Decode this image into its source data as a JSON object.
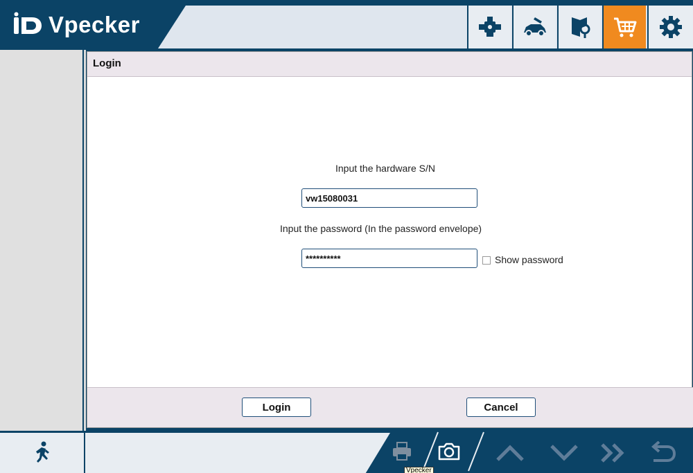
{
  "app": {
    "brand": "Vpecker",
    "logo_mark": "iD"
  },
  "header": {
    "nav": [
      {
        "icon": "engine-diagnostic-icon",
        "active": false
      },
      {
        "icon": "car-repair-icon",
        "active": false
      },
      {
        "icon": "manual-search-icon",
        "active": false
      },
      {
        "icon": "shopping-cart-icon",
        "active": true
      },
      {
        "icon": "gear-icon",
        "active": false
      }
    ]
  },
  "dialog": {
    "title": "Login",
    "sn_label": "Input the hardware S/N",
    "sn_value": "vw15080031",
    "password_label": "Input the password (In the password envelope)",
    "password_value": "**********",
    "show_password_label": "Show password",
    "show_password_checked": false,
    "login_button": "Login",
    "cancel_button": "Cancel"
  },
  "bottombar": {
    "tooltip": "Vpecker",
    "icons": [
      "exit-running-icon",
      "print-icon",
      "camera-icon",
      "scroll-up-icon",
      "scroll-down-icon",
      "fast-forward-icon",
      "back-icon"
    ]
  },
  "colors": {
    "primary": "#0b4366",
    "accent": "#f08a1f",
    "panel_bg": "#ece6ec"
  }
}
